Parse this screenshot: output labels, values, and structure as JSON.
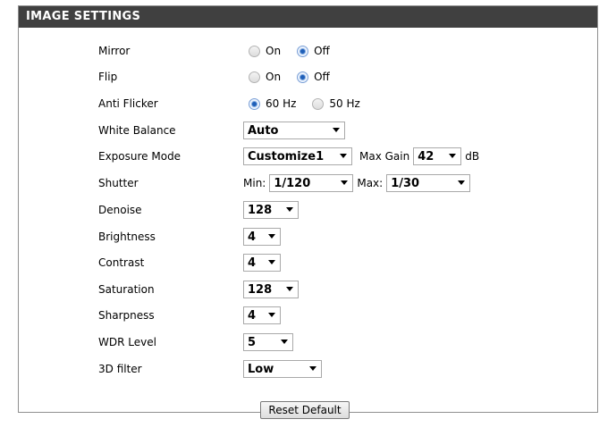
{
  "panel": {
    "title": "IMAGE SETTINGS"
  },
  "rows": {
    "mirror": {
      "label": "Mirror",
      "opt1": "On",
      "opt2": "Off",
      "selected": "Off"
    },
    "flip": {
      "label": "Flip",
      "opt1": "On",
      "opt2": "Off",
      "selected": "Off"
    },
    "anti_flicker": {
      "label": "Anti Flicker",
      "opt1": "60 Hz",
      "opt2": "50 Hz",
      "selected": "60 Hz"
    },
    "white_balance": {
      "label": "White Balance",
      "value": "Auto"
    },
    "exposure_mode": {
      "label": "Exposure Mode",
      "value": "Customize1",
      "max_gain_label": "Max Gain",
      "max_gain_value": "42",
      "max_gain_unit": "dB"
    },
    "shutter": {
      "label": "Shutter",
      "min_label": "Min:",
      "min_value": "1/120",
      "max_label": "Max:",
      "max_value": "1/30"
    },
    "denoise": {
      "label": "Denoise",
      "value": "128"
    },
    "brightness": {
      "label": "Brightness",
      "value": "4"
    },
    "contrast": {
      "label": "Contrast",
      "value": "4"
    },
    "saturation": {
      "label": "Saturation",
      "value": "128"
    },
    "sharpness": {
      "label": "Sharpness",
      "value": "4"
    },
    "wdr_level": {
      "label": "WDR Level",
      "value": "5"
    },
    "filter_3d": {
      "label": "3D filter",
      "value": "Low"
    }
  },
  "reset_button": "Reset Default",
  "icons": {
    "dropdown": "chevron-down-icon",
    "radio": "radio-icon"
  },
  "colors": {
    "header_bg": "#404040",
    "header_text": "#ffffff",
    "radio_selected": "#1f5fb8"
  }
}
